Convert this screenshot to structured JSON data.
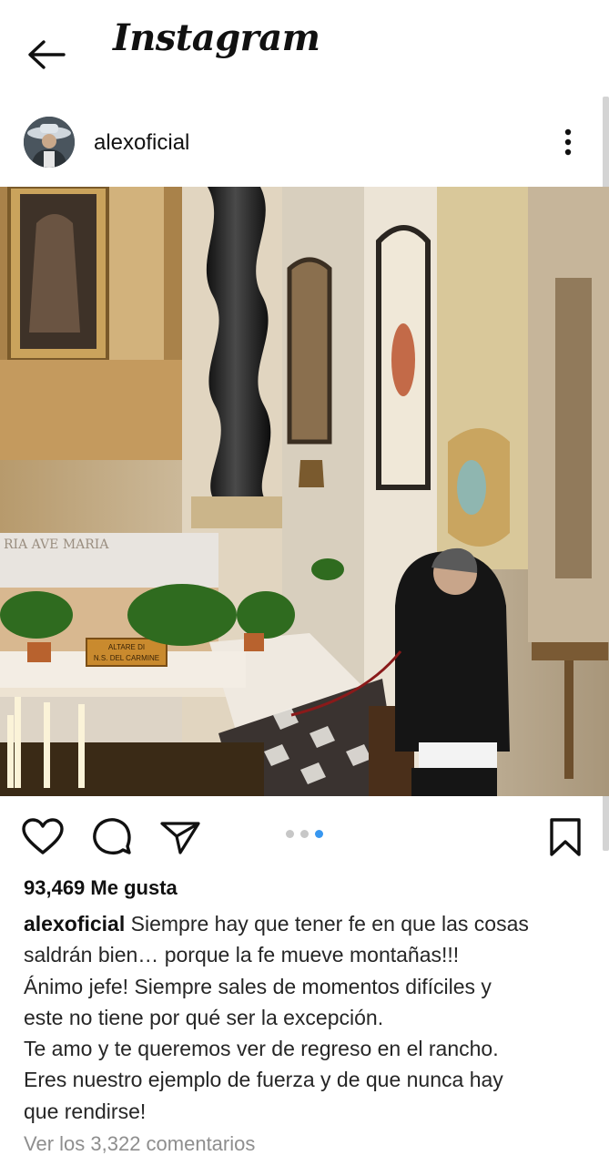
{
  "header": {
    "title": "Instagram",
    "back_icon": "arrow-left-icon"
  },
  "post": {
    "username": "alexoficial",
    "more_icon": "more-vertical-icon",
    "image": {
      "plaque_line1": "ALTARE DI",
      "plaque_line2": "N.S. DEL CARMINE",
      "inscription": "RIA   AVE MARIA"
    },
    "actions": {
      "like_icon": "heart-icon",
      "comment_icon": "comment-icon",
      "share_icon": "send-icon",
      "save_icon": "bookmark-icon"
    },
    "carousel": {
      "count": 3,
      "active_index": 2,
      "active_color": "#3897f0",
      "inactive_color": "#c7c7c7"
    },
    "likes": "93,469 Me gusta",
    "caption": {
      "user": "alexoficial",
      "lines": [
        "Siempre hay que tener fe en que las cosas",
        "saldrán bien… porque la fe mueve montañas!!!",
        "Ánimo jefe! Siempre sales de momentos difíciles y",
        "este no tiene por qué ser la excepción.",
        "Te amo y te queremos ver de regreso en el rancho.",
        "Eres nuestro ejemplo de fuerza y de que nunca hay",
        "que rendirse!"
      ]
    },
    "comments_link": "Ver los 3,322 comentarios"
  }
}
